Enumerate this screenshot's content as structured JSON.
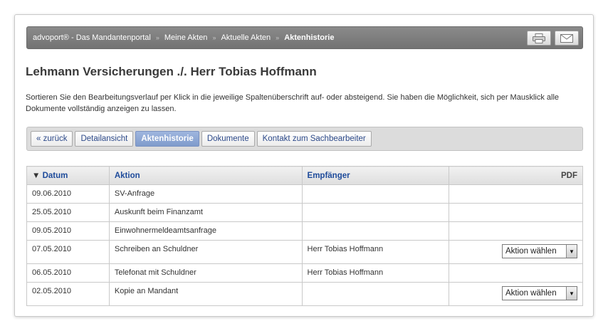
{
  "breadcrumb": {
    "items": [
      {
        "label": "advoport® - Das Mandantenportal"
      },
      {
        "label": "Meine Akten"
      },
      {
        "label": "Aktuelle Akten"
      },
      {
        "label": "Aktenhistorie"
      }
    ],
    "separator": "»"
  },
  "toolbar": {
    "print_icon": "printer-icon",
    "mail_icon": "mail-icon"
  },
  "page": {
    "title": "Lehmann Versicherungen ./. Herr Tobias Hoffmann",
    "intro": "Sortieren Sie den Bearbeitungsverlauf per Klick in die jeweilige Spaltenüberschrift auf- oder absteigend. Sie haben die Möglichkeit, sich per Mausklick alle Dokumente vollständig anzeigen zu lassen."
  },
  "tabs": [
    {
      "label": "« zurück"
    },
    {
      "label": "Detailansicht"
    },
    {
      "label": "Aktenhistorie",
      "active": true
    },
    {
      "label": "Dokumente"
    },
    {
      "label": "Kontakt zum Sachbearbeiter"
    }
  ],
  "table": {
    "headers": {
      "date": "Datum",
      "sort_indicator": "▼",
      "action": "Aktion",
      "recipient": "Empfänger",
      "pdf": "PDF"
    },
    "rows": [
      {
        "date": "09.06.2010",
        "action": "SV-Anfrage",
        "recipient": "",
        "pdf": ""
      },
      {
        "date": "25.05.2010",
        "action": "Auskunft beim Finanzamt",
        "recipient": "",
        "pdf": ""
      },
      {
        "date": "09.05.2010",
        "action": "Einwohnermeldeamtsanfrage",
        "recipient": "",
        "pdf": ""
      },
      {
        "date": "07.05.2010",
        "action": "Schreiben an Schuldner",
        "recipient": "Herr Tobias Hoffmann",
        "pdf": "Aktion wählen"
      },
      {
        "date": "06.05.2010",
        "action": "Telefonat mit Schuldner",
        "recipient": "Herr Tobias Hoffmann",
        "pdf": ""
      },
      {
        "date": "02.05.2010",
        "action": "Kopie an Mandant",
        "recipient": "",
        "pdf": "Aktion wählen"
      }
    ]
  },
  "colors": {
    "link": "#1e4b9b",
    "active_tab": "#8ea8d6",
    "crumbbar": "#808080"
  }
}
